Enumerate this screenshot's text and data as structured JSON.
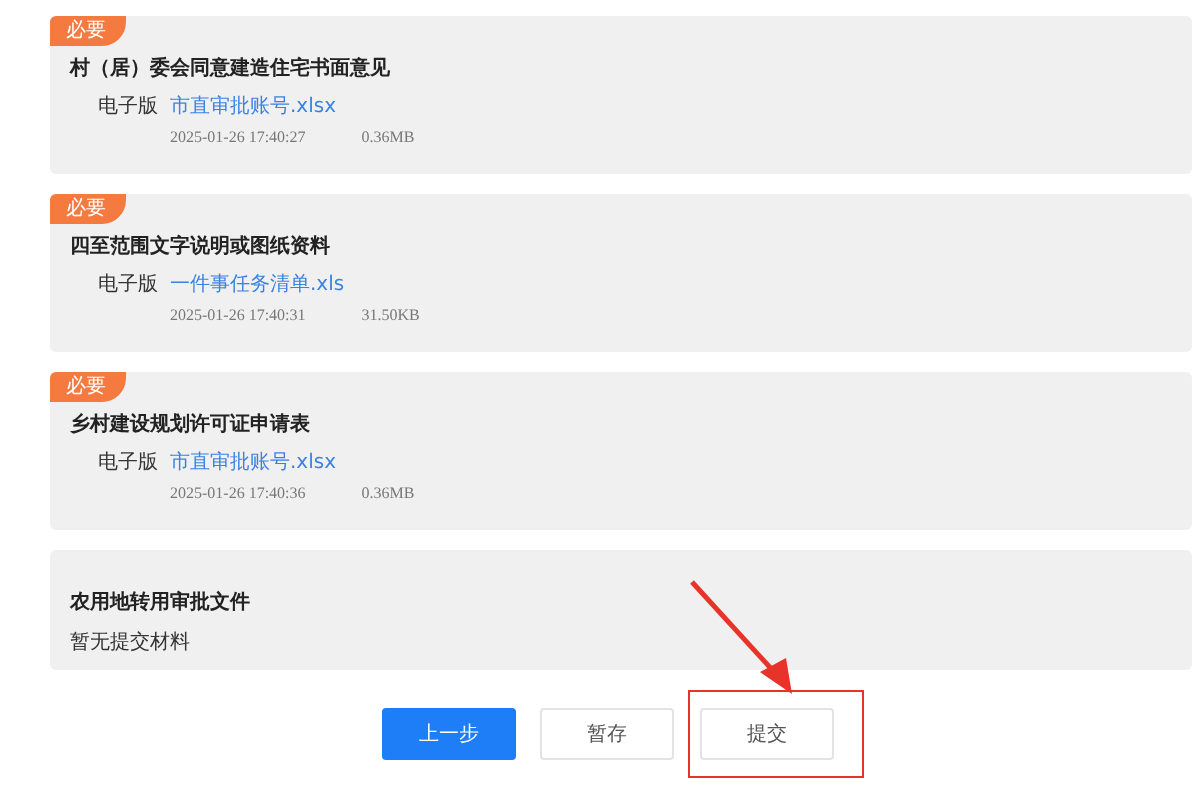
{
  "materials": [
    {
      "required": true,
      "badge": "必要",
      "title": "村（居）委会同意建造住宅书面意见",
      "files": [
        {
          "label": "电子版",
          "name": "市直审批账号.xlsx",
          "time": "2025-01-26 17:40:27",
          "size": "0.36MB"
        }
      ]
    },
    {
      "required": true,
      "badge": "必要",
      "title": "四至范围文字说明或图纸资料",
      "files": [
        {
          "label": "电子版",
          "name": "一件事任务清单.xls",
          "time": "2025-01-26 17:40:31",
          "size": "31.50KB"
        }
      ]
    },
    {
      "required": true,
      "badge": "必要",
      "title": "乡村建设规划许可证申请表",
      "files": [
        {
          "label": "电子版",
          "name": "市直审批账号.xlsx",
          "time": "2025-01-26 17:40:36",
          "size": "0.36MB"
        }
      ]
    },
    {
      "required": false,
      "title": "农用地转用审批文件",
      "empty_text": "暂无提交材料"
    }
  ],
  "buttons": [
    {
      "label": "上一步",
      "kind": "primary"
    },
    {
      "label": "暂存",
      "kind": "default"
    },
    {
      "label": "提交",
      "kind": "default",
      "highlighted": true
    }
  ]
}
